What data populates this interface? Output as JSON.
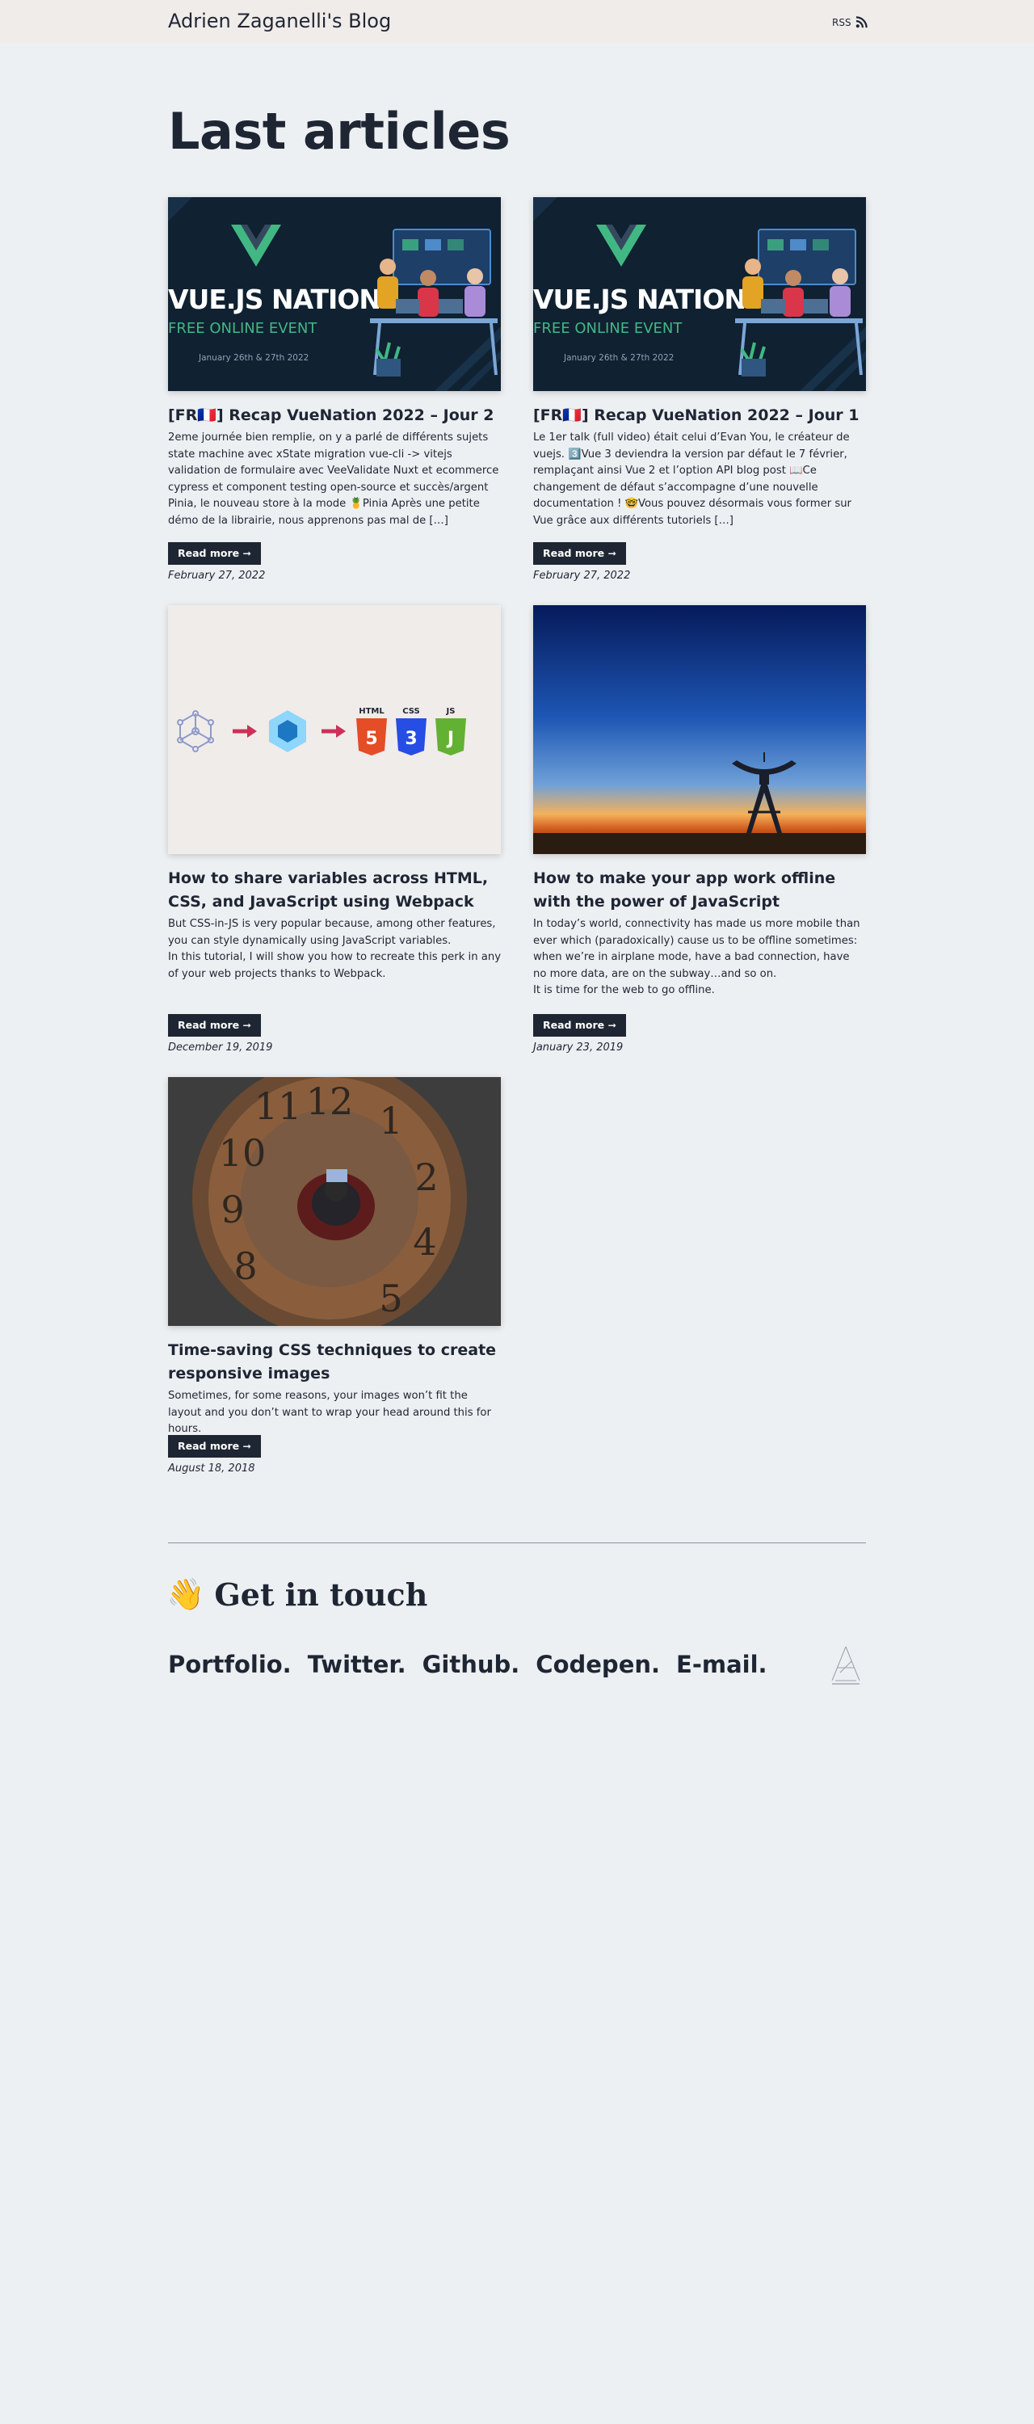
{
  "header": {
    "site_title": "Adrien Zaganelli's Blog",
    "rss_label": "RSS"
  },
  "main": {
    "title": "Last articles",
    "read_more_label": "Read more ➞",
    "articles": [
      {
        "title": "[FR🇫🇷] Recap VueNation 2022 – Jour 2",
        "excerpt": "2eme journée bien remplie, on y a parlé de différents sujets state machine avec xState migration vue-cli -> vitejs validation de formulaire avec VeeValidate Nuxt et ecommerce cypress et component testing open-source et succès/argent Pinia, le nouveau store à la mode 🍍Pinia Après une petite démo de la librairie, nous apprenons pas mal de […]",
        "date": "February 27, 2022",
        "image": {
          "brand": "VUE.JS NATION",
          "subtitle": "FREE ONLINE EVENT",
          "dates": "January 26th & 27th 2022"
        }
      },
      {
        "title": "[FR🇫🇷] Recap VueNation 2022 – Jour 1",
        "excerpt": "Le 1er talk (full video) était celui d’Evan You, le créateur de vuejs. 3️⃣Vue 3 deviendra la version par défaut le 7 février, remplaçant ainsi Vue 2 et l’option API blog post 📖Ce changement de défaut s’accompagne d’une nouvelle documentation ! 🤓Vous pouvez désormais vous former sur Vue grâce aux différents tutoriels […]",
        "date": "February 27, 2022",
        "image": {
          "brand": "VUE.JS NATION",
          "subtitle": "FREE ONLINE EVENT",
          "dates": "January 26th & 27th 2022"
        }
      },
      {
        "title": "How to share variables across HTML, CSS, and JavaScript using Webpack",
        "excerpt": "But CSS-in-JS is very popular because, among other features, you can style dynamically using JavaScript variables.\nIn this tutorial, I will show you how to recreate this perk in any of your web projects thanks to Webpack.",
        "date": "December 19, 2019",
        "image": {
          "html": "HTML",
          "css": "CSS",
          "js": "JS"
        }
      },
      {
        "title": "How to make your app work offline with the power of JavaScript",
        "excerpt": "In today’s world, connectivity has made us more mobile than ever which (paradoxically) cause us to be offline sometimes: when we’re in airplane mode, have a bad connection, have no more data, are on the subway…and so on.\nIt is time for the web to go offline.",
        "date": "January 23, 2019"
      },
      {
        "title": "Time-saving CSS techniques to create responsive images",
        "excerpt": "Sometimes, for some reasons, your images won’t fit the layout and you don’t want to wrap your head around this for hours.",
        "date": "August 18, 2018"
      }
    ]
  },
  "footer": {
    "heading_emoji": "👋",
    "heading": "Get in touch",
    "links": [
      "Portfolio.",
      "Twitter.",
      "Github.",
      "Codepen.",
      "E-mail."
    ]
  },
  "colors": {
    "background": "#edf0f3",
    "header_bg": "#f0ecea",
    "text": "#1f2633",
    "button_bg": "#1f2633",
    "vue_green": "#41b883"
  }
}
